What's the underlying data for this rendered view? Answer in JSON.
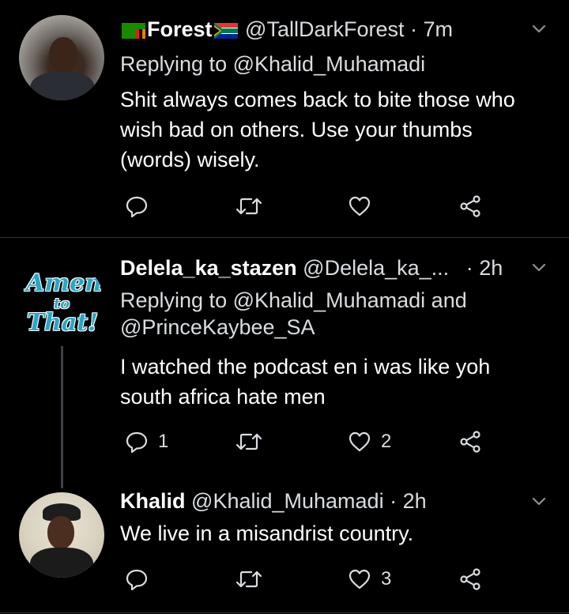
{
  "colors": {
    "background": "#000000",
    "divider": "#2f3336",
    "text_primary": "#ffffff",
    "text_secondary": "#d9dde1",
    "amen_accent": "#2aa6c4"
  },
  "tweets": [
    {
      "name": "Forest",
      "name_prefix_icon": "zambia-flag-icon",
      "name_suffix_icon": "south-africa-flag-icon",
      "handle": "@TallDarkForest",
      "separator": "·",
      "time": "7m",
      "replying_prefix": "Replying to",
      "replying_to": [
        "@Khalid_Muhamadi"
      ],
      "text": "Shit always comes back to bite those who wish bad on others. Use your thumbs (words) wisely.",
      "reply_count": "",
      "retweet_count": "",
      "like_count": ""
    },
    {
      "name": "Delela_ka_stazen",
      "handle": "@Delela_ka_...",
      "separator": "·",
      "time": "2h",
      "avatar_text": [
        "Amen",
        "to",
        "That!"
      ],
      "replying_prefix": "Replying to",
      "replying_to": [
        "@Khalid_Muhamadi",
        "@PrinceKaybee_SA"
      ],
      "replying_joiner": "and",
      "text": "I watched the podcast en i was like yoh south africa  hate men",
      "reply_count": "1",
      "retweet_count": "",
      "like_count": "2"
    },
    {
      "name": "Khalid",
      "handle": "@Khalid_Muhamadi",
      "separator": "·",
      "time": "2h",
      "text": "We live in a misandrist country.",
      "reply_count": "",
      "retweet_count": "",
      "like_count": "3"
    }
  ],
  "icons": {
    "reply": "reply-icon",
    "retweet": "retweet-icon",
    "like": "heart-icon",
    "share": "share-icon",
    "more": "chevron-down-icon"
  }
}
